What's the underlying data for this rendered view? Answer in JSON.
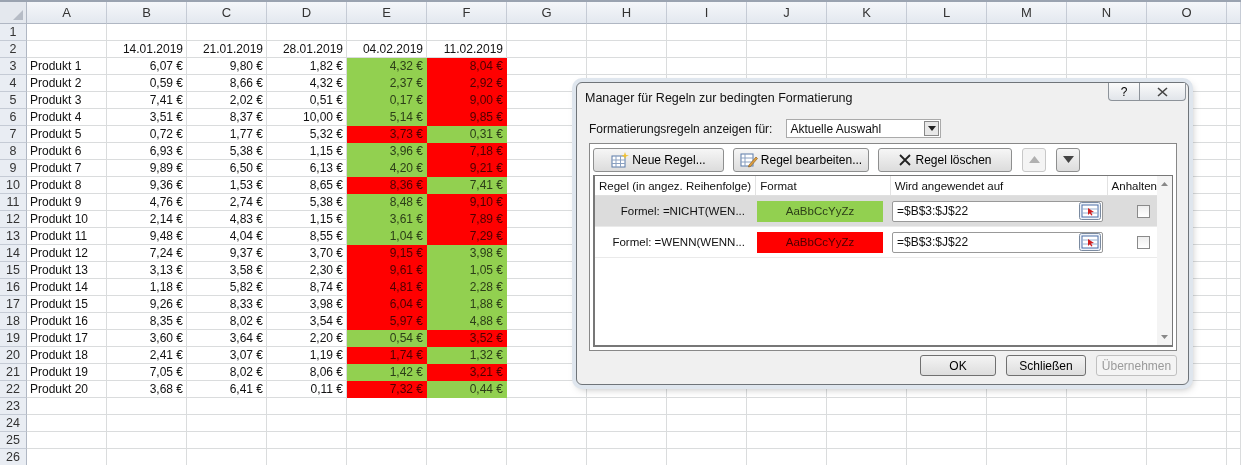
{
  "sheet": {
    "columns": [
      "A",
      "B",
      "C",
      "D",
      "E",
      "F",
      "G",
      "H",
      "I",
      "J",
      "K",
      "L",
      "M",
      "N",
      "O"
    ],
    "rows": [
      {
        "n": "1",
        "cells": []
      },
      {
        "n": "2",
        "cells": [
          {
            "text": ""
          },
          {
            "text": "14.01.2019"
          },
          {
            "text": "21.01.2019"
          },
          {
            "text": "28.01.2019"
          },
          {
            "text": "04.02.2019"
          },
          {
            "text": "11.02.2019"
          }
        ]
      },
      {
        "n": "3",
        "cells": [
          {
            "text": "Produkt 1"
          },
          {
            "text": "6,07 €"
          },
          {
            "text": "9,80 €"
          },
          {
            "text": "1,82 €"
          },
          {
            "text": "4,32 €",
            "color": "#92d050"
          },
          {
            "text": "8,04 €",
            "color": "#ff0000"
          }
        ]
      },
      {
        "n": "4",
        "cells": [
          {
            "text": "Produkt 2"
          },
          {
            "text": "0,59 €"
          },
          {
            "text": "8,66 €"
          },
          {
            "text": "4,32 €"
          },
          {
            "text": "2,37 €",
            "color": "#92d050"
          },
          {
            "text": "2,92 €",
            "color": "#ff0000"
          }
        ]
      },
      {
        "n": "5",
        "cells": [
          {
            "text": "Produkt 3"
          },
          {
            "text": "7,41 €"
          },
          {
            "text": "2,02 €"
          },
          {
            "text": "0,51 €"
          },
          {
            "text": "0,17 €",
            "color": "#92d050"
          },
          {
            "text": "9,00 €",
            "color": "#ff0000"
          }
        ]
      },
      {
        "n": "6",
        "cells": [
          {
            "text": "Produkt 4"
          },
          {
            "text": "3,51 €"
          },
          {
            "text": "8,37 €"
          },
          {
            "text": "10,00 €"
          },
          {
            "text": "5,14 €",
            "color": "#92d050"
          },
          {
            "text": "9,85 €",
            "color": "#ff0000"
          }
        ]
      },
      {
        "n": "7",
        "cells": [
          {
            "text": "Produkt 5"
          },
          {
            "text": "0,72 €"
          },
          {
            "text": "1,77 €"
          },
          {
            "text": "5,32 €"
          },
          {
            "text": "3,73 €",
            "color": "#ff0000"
          },
          {
            "text": "0,31 €",
            "color": "#92d050"
          }
        ]
      },
      {
        "n": "8",
        "cells": [
          {
            "text": "Produkt 6"
          },
          {
            "text": "6,93 €"
          },
          {
            "text": "5,38 €"
          },
          {
            "text": "1,15 €"
          },
          {
            "text": "3,96 €",
            "color": "#92d050"
          },
          {
            "text": "7,18 €",
            "color": "#ff0000"
          }
        ]
      },
      {
        "n": "9",
        "cells": [
          {
            "text": "Produkt 7"
          },
          {
            "text": "9,89 €"
          },
          {
            "text": "6,50 €"
          },
          {
            "text": "6,13 €"
          },
          {
            "text": "4,20 €",
            "color": "#92d050"
          },
          {
            "text": "9,21 €",
            "color": "#ff0000"
          }
        ]
      },
      {
        "n": "10",
        "cells": [
          {
            "text": "Produkt 8"
          },
          {
            "text": "9,36 €"
          },
          {
            "text": "1,53 €"
          },
          {
            "text": "8,65 €"
          },
          {
            "text": "8,36 €",
            "color": "#ff0000"
          },
          {
            "text": "7,41 €",
            "color": "#92d050"
          }
        ]
      },
      {
        "n": "11",
        "cells": [
          {
            "text": "Produkt 9"
          },
          {
            "text": "4,76 €"
          },
          {
            "text": "2,74 €"
          },
          {
            "text": "5,38 €"
          },
          {
            "text": "8,48 €",
            "color": "#92d050"
          },
          {
            "text": "9,10 €",
            "color": "#ff0000"
          }
        ]
      },
      {
        "n": "12",
        "cells": [
          {
            "text": "Produkt 10"
          },
          {
            "text": "2,14 €"
          },
          {
            "text": "4,83 €"
          },
          {
            "text": "1,15 €"
          },
          {
            "text": "3,61 €",
            "color": "#92d050"
          },
          {
            "text": "7,89 €",
            "color": "#ff0000"
          }
        ]
      },
      {
        "n": "13",
        "cells": [
          {
            "text": "Produkt 11"
          },
          {
            "text": "9,48 €"
          },
          {
            "text": "4,04 €"
          },
          {
            "text": "8,55 €"
          },
          {
            "text": "1,04 €",
            "color": "#92d050"
          },
          {
            "text": "7,29 €",
            "color": "#ff0000"
          }
        ]
      },
      {
        "n": "14",
        "cells": [
          {
            "text": "Produkt 12"
          },
          {
            "text": "7,24 €"
          },
          {
            "text": "9,37 €"
          },
          {
            "text": "3,70 €"
          },
          {
            "text": "9,15 €",
            "color": "#ff0000"
          },
          {
            "text": "3,98 €",
            "color": "#92d050"
          }
        ]
      },
      {
        "n": "15",
        "cells": [
          {
            "text": "Produkt 13"
          },
          {
            "text": "3,13 €"
          },
          {
            "text": "3,58 €"
          },
          {
            "text": "2,30 €"
          },
          {
            "text": "9,61 €",
            "color": "#ff0000"
          },
          {
            "text": "1,05 €",
            "color": "#92d050"
          }
        ]
      },
      {
        "n": "16",
        "cells": [
          {
            "text": "Produkt 14"
          },
          {
            "text": "1,18 €"
          },
          {
            "text": "5,82 €"
          },
          {
            "text": "8,74 €"
          },
          {
            "text": "4,81 €",
            "color": "#ff0000"
          },
          {
            "text": "2,28 €",
            "color": "#92d050"
          }
        ]
      },
      {
        "n": "17",
        "cells": [
          {
            "text": "Produkt 15"
          },
          {
            "text": "9,26 €"
          },
          {
            "text": "8,33 €"
          },
          {
            "text": "3,98 €"
          },
          {
            "text": "6,04 €",
            "color": "#ff0000"
          },
          {
            "text": "1,88 €",
            "color": "#92d050"
          }
        ]
      },
      {
        "n": "18",
        "cells": [
          {
            "text": "Produkt 16"
          },
          {
            "text": "8,35 €"
          },
          {
            "text": "8,02 €"
          },
          {
            "text": "3,54 €"
          },
          {
            "text": "5,97 €",
            "color": "#ff0000"
          },
          {
            "text": "4,88 €",
            "color": "#92d050"
          }
        ]
      },
      {
        "n": "19",
        "cells": [
          {
            "text": "Produkt 17"
          },
          {
            "text": "3,60 €"
          },
          {
            "text": "3,64 €"
          },
          {
            "text": "2,20 €"
          },
          {
            "text": "0,54 €",
            "color": "#92d050"
          },
          {
            "text": "3,52 €",
            "color": "#ff0000"
          }
        ]
      },
      {
        "n": "20",
        "cells": [
          {
            "text": "Produkt 18"
          },
          {
            "text": "2,41 €"
          },
          {
            "text": "3,07 €"
          },
          {
            "text": "1,19 €"
          },
          {
            "text": "1,74 €",
            "color": "#ff0000"
          },
          {
            "text": "1,32 €",
            "color": "#92d050"
          }
        ]
      },
      {
        "n": "21",
        "cells": [
          {
            "text": "Produkt 19"
          },
          {
            "text": "7,05 €"
          },
          {
            "text": "8,02 €"
          },
          {
            "text": "8,06 €"
          },
          {
            "text": "1,42 €",
            "color": "#92d050"
          },
          {
            "text": "3,21 €",
            "color": "#ff0000"
          }
        ]
      },
      {
        "n": "22",
        "cells": [
          {
            "text": "Produkt 20"
          },
          {
            "text": "3,68 €"
          },
          {
            "text": "6,41 €"
          },
          {
            "text": "0,11 €"
          },
          {
            "text": "7,32 €",
            "color": "#ff0000"
          },
          {
            "text": "0,44 €",
            "color": "#92d050"
          }
        ]
      },
      {
        "n": "23",
        "cells": []
      },
      {
        "n": "24",
        "cells": []
      },
      {
        "n": "25",
        "cells": []
      },
      {
        "n": "26",
        "cells": []
      }
    ]
  },
  "dialog": {
    "title": "Manager für Regeln zur bedingten Formatierung",
    "help": "?",
    "scope_label": "Formatierungsregeln anzeigen für:",
    "scope_value": "Aktuelle Auswahl",
    "toolbar": [
      {
        "kind": "new",
        "label": "Neue Regel..."
      },
      {
        "kind": "edit",
        "label": "Regel bearbeiten..."
      },
      {
        "kind": "delete",
        "label": "Regel löschen"
      },
      {
        "kind": "up",
        "disabled": true
      },
      {
        "kind": "down",
        "disabled": false
      }
    ],
    "columns": [
      "Regel (in angez. Reihenfolge)",
      "Format",
      "Wird angewendet auf",
      "Anhalten"
    ],
    "rules": [
      {
        "rule": "Formel: =NICHT(WEN...",
        "preview": "AaBbCcYyZz",
        "color": "#92d050",
        "applies_to": "=$B$3:$J$22",
        "stop": false,
        "selected": true
      },
      {
        "rule": "Formel: =WENN(WENN...",
        "preview": "AaBbCcYyZz",
        "color": "#ff0000",
        "applies_to": "=$B$3:$J$22",
        "stop": false,
        "selected": false
      }
    ],
    "buttons": [
      {
        "label": "OK",
        "disabled": false
      },
      {
        "label": "Schließen",
        "disabled": false
      },
      {
        "label": "Übernehmen",
        "disabled": true
      }
    ]
  }
}
